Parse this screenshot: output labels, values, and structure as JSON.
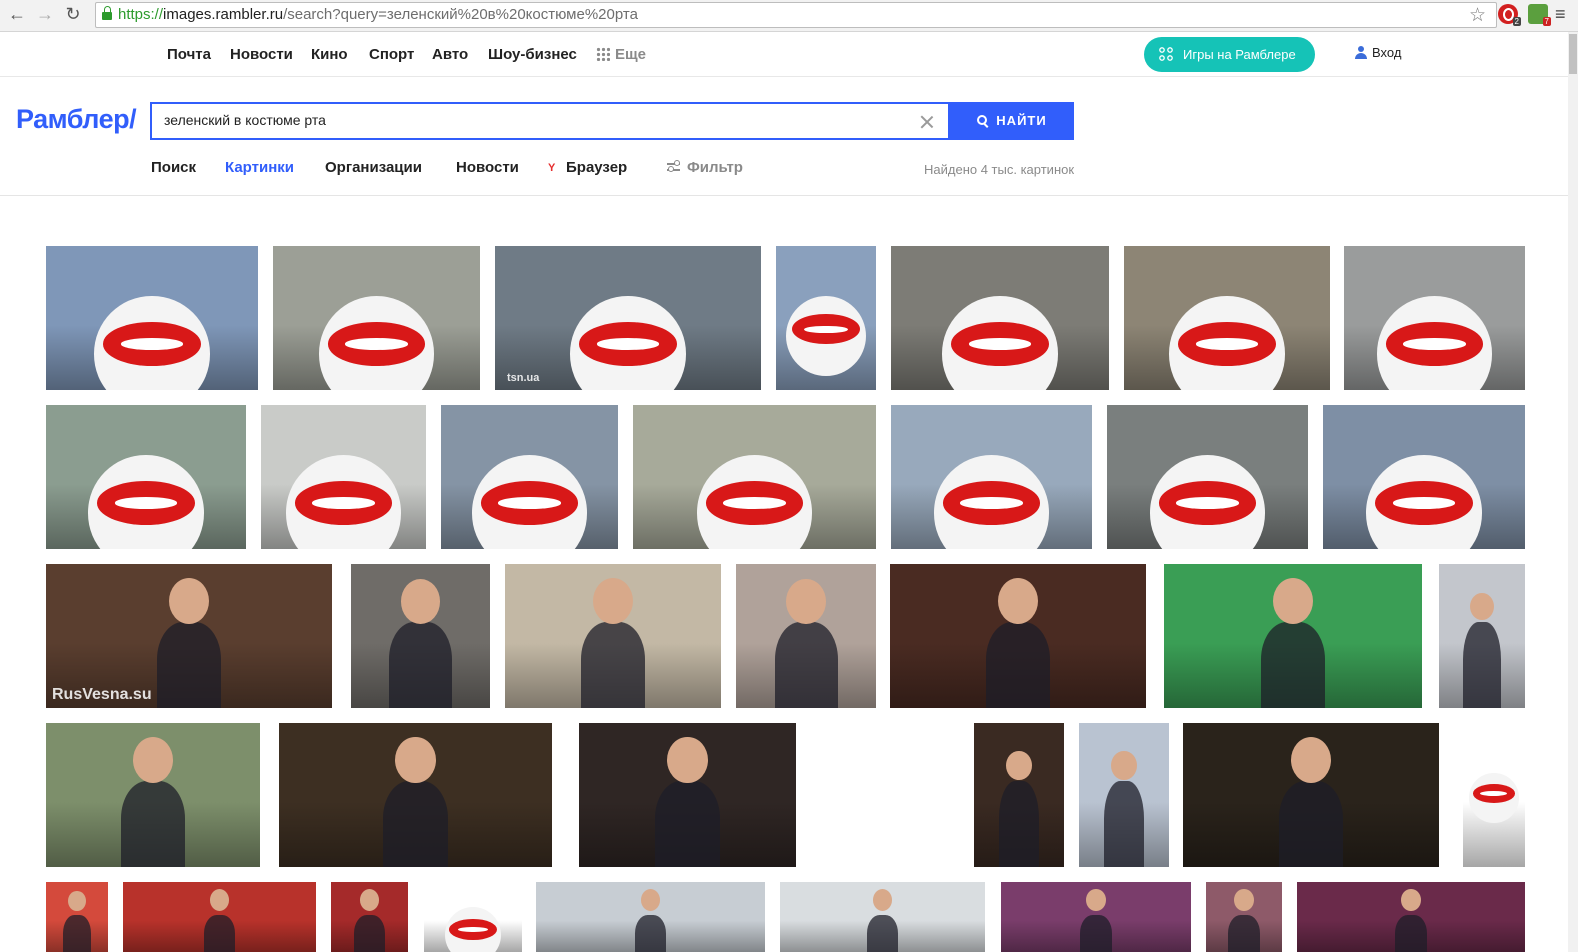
{
  "browser": {
    "url_protocol": "https://",
    "url_host": "images.rambler.ru",
    "url_path": "/search?query=зеленский%20в%20костюме%20рта",
    "ext_badge_1": "2",
    "ext_badge_2": "7"
  },
  "topnav": {
    "items": [
      "Почта",
      "Новости",
      "Кино",
      "Спорт",
      "Авто",
      "Шоу-бизнес"
    ],
    "more": "Еще",
    "games_button": "Игры на Рамблере",
    "login": "Вход"
  },
  "search": {
    "logo": "Рамблер/",
    "query": "зеленский в костюме рта",
    "button": "НАЙТИ"
  },
  "tabs": {
    "items": [
      "Поиск",
      "Картинки",
      "Организации",
      "Новости",
      "Браузер"
    ],
    "active": "Картинки",
    "filter": "Фильтр",
    "found": "Найдено 4 тыс. картинок"
  },
  "colors": {
    "accent": "#315efb",
    "games": "#15c3b7"
  },
  "images": {
    "watermarks": [
      "tsn.ua",
      "RusVesna.su"
    ]
  }
}
